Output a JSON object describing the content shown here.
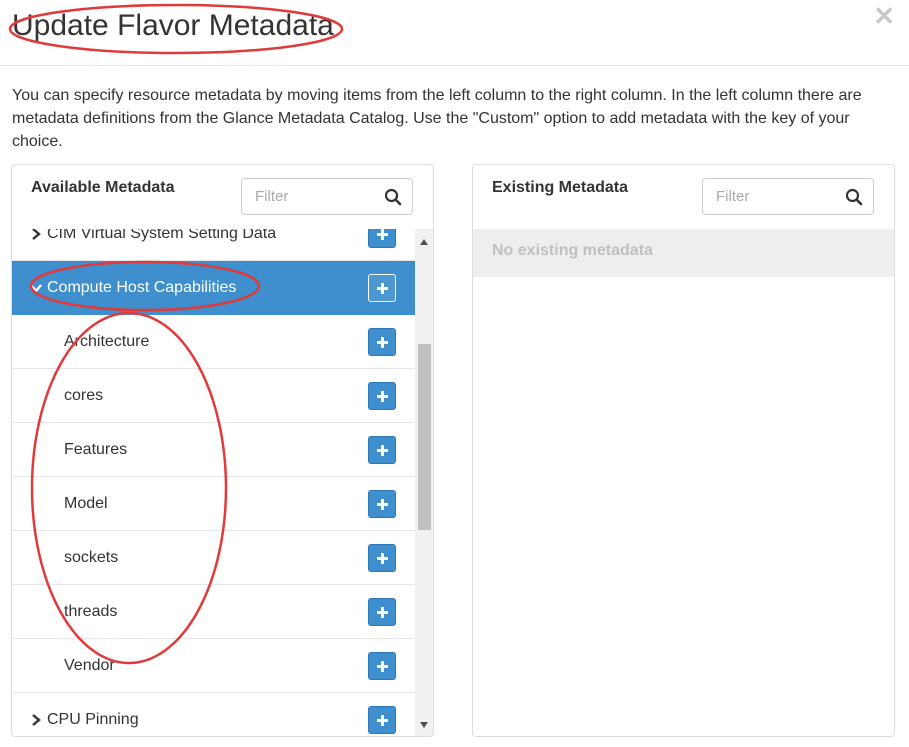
{
  "modal": {
    "title": "Update Flavor Metadata",
    "description": "You can specify resource metadata by moving items from the left column to the right column. In the left column there are metadata definitions from the Glance Metadata Catalog. Use the \"Custom\" option to add metadata with the key of your choice."
  },
  "available": {
    "title": "Available Metadata",
    "filter_placeholder": "Filter",
    "rows": [
      {
        "label": "CIM Virtual System Setting Data",
        "kind": "group",
        "expanded": false
      },
      {
        "label": "Compute Host Capabilities",
        "kind": "group",
        "expanded": true,
        "selected": true
      },
      {
        "label": "Architecture",
        "kind": "item"
      },
      {
        "label": "cores",
        "kind": "item"
      },
      {
        "label": "Features",
        "kind": "item"
      },
      {
        "label": "Model",
        "kind": "item"
      },
      {
        "label": "sockets",
        "kind": "item"
      },
      {
        "label": "threads",
        "kind": "item"
      },
      {
        "label": "Vendor",
        "kind": "item"
      },
      {
        "label": "CPU Pinning",
        "kind": "group",
        "expanded": false
      }
    ]
  },
  "existing": {
    "title": "Existing Metadata",
    "filter_placeholder": "Filter",
    "empty_text": "No existing metadata"
  },
  "colors": {
    "accent": "#3f8ecd",
    "annotation": "#e03a3a"
  },
  "icons": {
    "close": "close-icon",
    "search": "search-icon",
    "add": "plus-icon",
    "collapsed": "chevron-right-icon",
    "expanded": "chevron-down-icon"
  }
}
